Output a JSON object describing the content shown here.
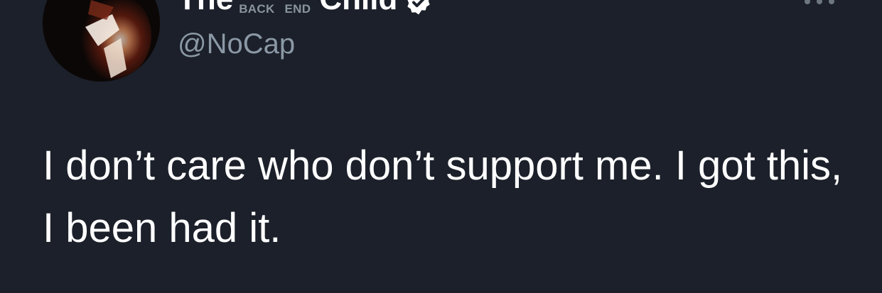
{
  "tweet": {
    "author": {
      "name_start": "The",
      "name_emoji_labels": [
        "BACK",
        "END"
      ],
      "name_end": "Child",
      "handle": "@NoCap",
      "verified_icon": "verified-badge-icon",
      "avatar_icon": "profile-photo"
    },
    "more_icon": "more-options-icon",
    "text": "I don’t care who don’t support me. I got this, I been had it."
  },
  "colors": {
    "background": "#1b202a",
    "text": "#ffffff",
    "secondary_text": "#8b98a5"
  }
}
